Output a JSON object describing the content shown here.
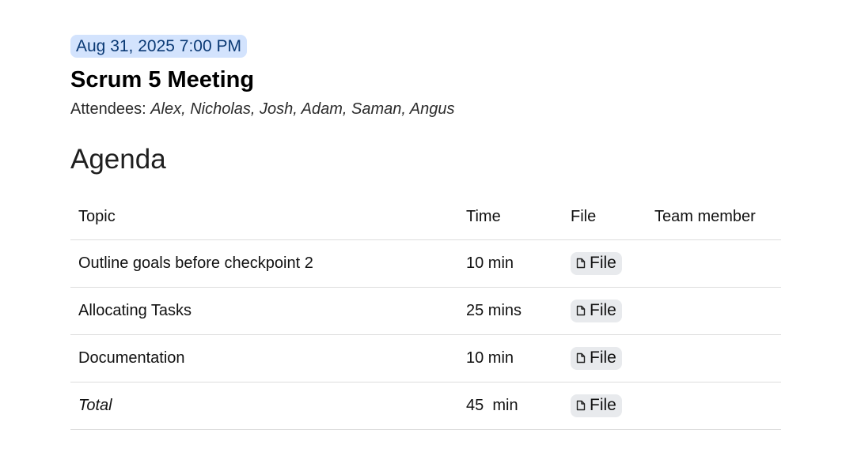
{
  "meeting": {
    "date_chip": "Aug 31, 2025 7:00 PM",
    "title": "Scrum 5 Meeting",
    "attendees_label": "Attendees: ",
    "attendees": "Alex, Nicholas, Josh, Adam, Saman, Angus"
  },
  "agenda": {
    "heading": "Agenda",
    "columns": [
      "Topic",
      "Time",
      "File",
      "Team member"
    ],
    "rows": [
      {
        "topic": "Outline goals before checkpoint 2",
        "time": "10 min",
        "file": "File",
        "member": ""
      },
      {
        "topic": "Allocating Tasks",
        "time": "25 mins",
        "file": "File",
        "member": ""
      },
      {
        "topic": "Documentation",
        "time": "10 min",
        "file": "File",
        "member": ""
      },
      {
        "topic": "Total",
        "time": "45  min",
        "file": "File",
        "member": ""
      }
    ]
  },
  "icons": {
    "file_chip": "document-icon"
  }
}
